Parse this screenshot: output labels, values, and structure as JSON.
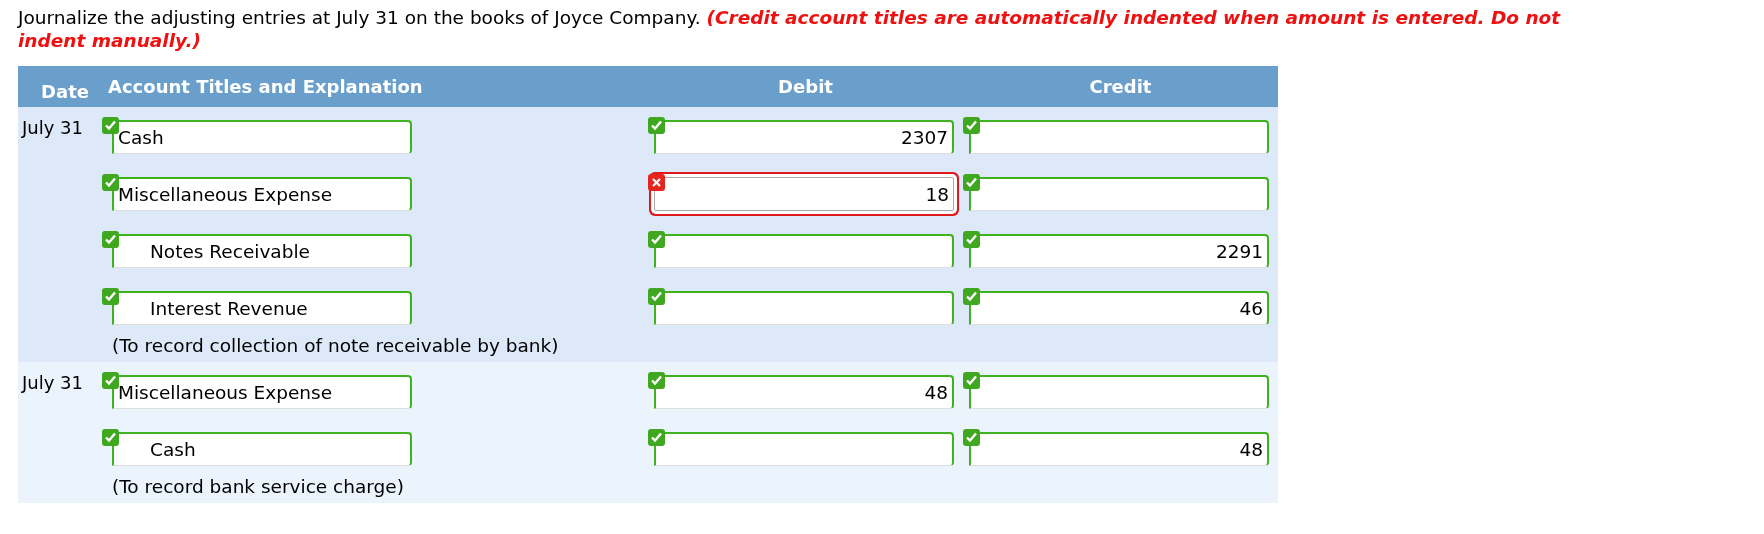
{
  "instruction": "Journalize the adjusting entries at July 31 on the books of Joyce Company. *(Credit account titles are automatically indented when amount is entered. Do not indent manually.)*",
  "table": {
    "columns": [
      "Date",
      "Account Titles and Explanation",
      "Debit",
      "Credit"
    ],
    "entries": [
      {
        "date": "July 31",
        "explanation": "(To record collection of note receivable by bank)",
        "lines": [
          {
            "account": {
              "value": "Cash",
              "correct": true
            },
            "indented": false,
            "debit": {
              "value": "2307",
              "correct": true
            },
            "credit": {
              "correct": true
            }
          },
          {
            "account": {
              "value": "Miscellaneous Expense",
              "correct": true
            },
            "indented": false,
            "debit": {
              "value": "18",
              "correct": false
            },
            "credit": {
              "correct": true
            }
          },
          {
            "account": {
              "value": "Notes Receivable",
              "correct": true
            },
            "indented": true,
            "debit": {
              "correct": true
            },
            "credit": {
              "value": "2291",
              "correct": true
            }
          },
          {
            "account": {
              "value": "Interest Revenue",
              "correct": true
            },
            "indented": true,
            "debit": {
              "correct": true
            },
            "credit": {
              "value": "46",
              "correct": true
            }
          }
        ]
      },
      {
        "date": "July 31",
        "explanation": "(To record bank service charge)",
        "lines": [
          {
            "account": {
              "value": "Miscellaneous Expense",
              "correct": true
            },
            "indented": false,
            "debit": {
              "value": "48",
              "correct": true
            },
            "credit": {
              "correct": true
            }
          },
          {
            "account": {
              "value": "Cash",
              "correct": true
            },
            "indented": true,
            "debit": {
              "correct": true
            },
            "credit": {
              "value": "48",
              "correct": true
            }
          }
        ]
      }
    ]
  }
}
